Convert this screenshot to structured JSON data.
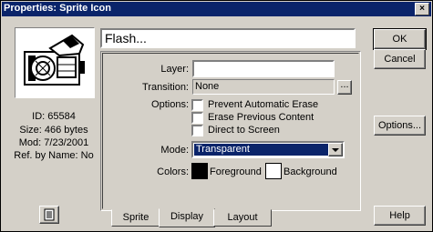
{
  "window": {
    "title": "Properties: Sprite Icon",
    "close_glyph": "×"
  },
  "info": {
    "id": "ID: 65584",
    "size": "Size: 466 bytes",
    "mod": "Mod: 7/23/2001",
    "ref": "Ref. by Name: No"
  },
  "name_field": {
    "value": "Flash..."
  },
  "form": {
    "layer_label": "Layer:",
    "layer_value": "",
    "transition_label": "Transition:",
    "transition_value": "None",
    "browse_label": "...",
    "options_label": "Options:",
    "options": [
      {
        "label": "Prevent Automatic Erase",
        "checked": false
      },
      {
        "label": "Erase Previous Content",
        "checked": false
      },
      {
        "label": "Direct to Screen",
        "checked": false
      }
    ],
    "mode_label": "Mode:",
    "mode_value": "Transparent",
    "colors_label": "Colors:",
    "foreground_label": "Foreground",
    "background_label": "Background",
    "foreground_color": "#000000",
    "background_color": "#ffffff"
  },
  "tabs": [
    "Sprite",
    "Display",
    "Layout"
  ],
  "active_tab": "Display",
  "buttons": {
    "ok": "OK",
    "cancel": "Cancel",
    "options": "Options...",
    "help": "Help"
  },
  "icons": {
    "thumbnail": "camera-icon",
    "open": "document-icon",
    "dropdown": "chevron-down-icon"
  }
}
